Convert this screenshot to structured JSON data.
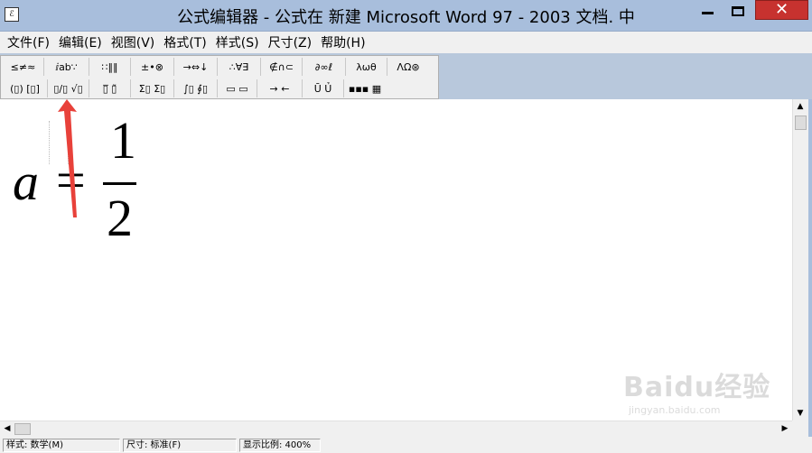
{
  "window": {
    "title": "公式编辑器 - 公式在 新建 Microsoft Word 97 - 2003 文档. 中",
    "app_icon": "equation-editor-icon",
    "close_glyph": "✕",
    "accent_color": "#a8bedc",
    "close_color": "#c7322f"
  },
  "menubar": {
    "items": [
      "文件(F)",
      "编辑(E)",
      "视图(V)",
      "格式(T)",
      "样式(S)",
      "尺寸(Z)",
      "帮助(H)"
    ]
  },
  "palette": {
    "row1": [
      "≤≠≈",
      "ⅈab∵",
      "∷‖‖",
      "±•⊗",
      "→⇔↓",
      "∴∀∃",
      "∉∩⊂",
      "∂∞ℓ",
      "λωθ",
      "ΛΩ⊛"
    ],
    "row2": [
      "(▯) [▯]",
      "▯∕▯ √▯",
      "▯̅ ▯̃",
      "Σ▯ Σ▯",
      "∫▯ ∮▯",
      "▭ ▭",
      "→ ←",
      "Ū Ủ",
      "▪▪▪ ▦"
    ]
  },
  "formula": {
    "variable": "a",
    "operator": "=",
    "numerator": "1",
    "denominator": "2"
  },
  "annotation": {
    "arrow_color": "#e8413a",
    "points_to": "fraction-template-button"
  },
  "statusbar": {
    "style": "样式: 数学(M)",
    "size": "尺寸: 标准(F)",
    "zoom": "显示比例: 400%"
  },
  "watermark": {
    "main": "Baidu经验",
    "sub": "jingyan.baidu.com"
  }
}
